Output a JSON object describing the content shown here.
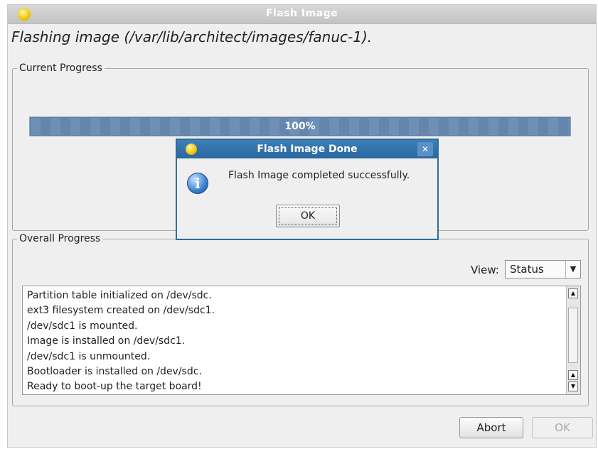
{
  "window": {
    "title": "Flash Image"
  },
  "heading": "Flashing image (/var/lib/architect/images/fanuc-1).",
  "current": {
    "legend": "Current Progress",
    "progress_text": "100%",
    "progress_fraction": 1.0
  },
  "overall": {
    "legend": "Overall Progress",
    "view_label": "View:",
    "view_selected": "Status",
    "log": [
      "Partition table initialized on /dev/sdc.",
      "ext3 filesystem created on /dev/sdc1.",
      "/dev/sdc1 is mounted.",
      "Image is installed on /dev/sdc1.",
      "/dev/sdc1 is unmounted.",
      "Bootloader is installed on /dev/sdc.",
      "Ready to boot-up the target board!"
    ]
  },
  "buttons": {
    "abort": "Abort",
    "ok": "OK"
  },
  "dialog": {
    "title": "Flash Image Done",
    "message": "Flash Image completed successfully.",
    "ok": "OK"
  }
}
